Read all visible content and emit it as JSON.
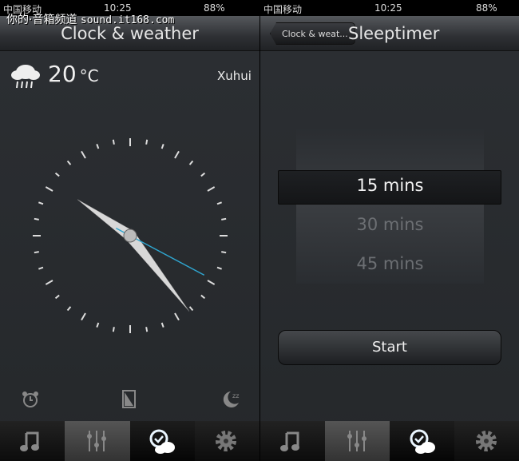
{
  "watermark": {
    "cn": "你的·音箱频道",
    "url": "sound.it168.com"
  },
  "status": {
    "carrier": "中国移动",
    "time": "10:25",
    "battery": "88%"
  },
  "left": {
    "title": "Clock & weather",
    "temperature": "20",
    "unit": "°C",
    "location": "Xuhui",
    "weather_icon": "cloud-rain-icon",
    "clock_time": "10:25",
    "bottom_icons": [
      "alarm-clock-icon",
      "screen-brightness-icon",
      "moon-sleep-icon"
    ]
  },
  "right": {
    "title": "Sleeptimer",
    "back_label": "Clock & weat...",
    "picker": [
      "15 mins",
      "30 mins",
      "45 mins"
    ],
    "selected": "15 mins",
    "start_label": "Start"
  },
  "tabs": [
    {
      "icon": "music-note-icon"
    },
    {
      "icon": "equalizer-icon"
    },
    {
      "icon": "clock-weather-icon",
      "active": true
    },
    {
      "icon": "gear-icon"
    }
  ],
  "colors": {
    "accent": "#4fb6e0",
    "second_hand": "#2fa6d0"
  }
}
